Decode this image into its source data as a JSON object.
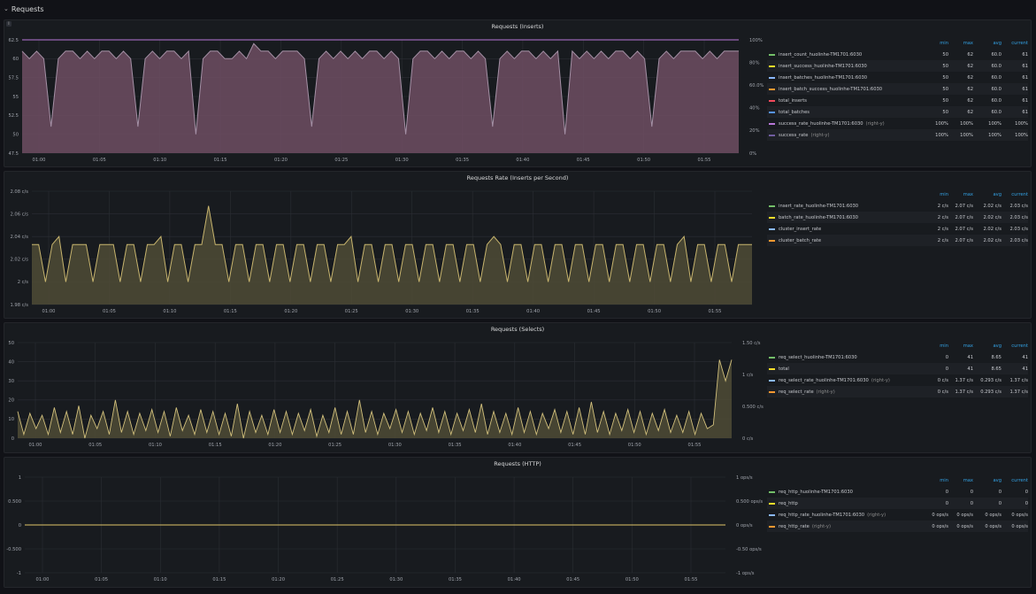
{
  "row": {
    "title": "Requests"
  },
  "panels": [
    {
      "title": "Requests (Inserts)",
      "legend": {
        "columns": [
          "min",
          "max",
          "avg",
          "current"
        ],
        "rows": [
          {
            "name": "insert_count_huolinhe-TM1701:6030",
            "axis": "",
            "color": "#73bf69",
            "vals": [
              "50",
              "62",
              "60.0",
              "61"
            ]
          },
          {
            "name": "insert_success_huolinhe-TM1701:6030",
            "axis": "",
            "color": "#fade2a",
            "vals": [
              "50",
              "62",
              "60.0",
              "61"
            ]
          },
          {
            "name": "insert_batches_huolinhe-TM1701:6030",
            "axis": "",
            "color": "#8ab8ff",
            "vals": [
              "50",
              "62",
              "60.0",
              "61"
            ]
          },
          {
            "name": "insert_batch_success_huolinhe-TM1701:6030",
            "axis": "",
            "color": "#ff9830",
            "vals": [
              "50",
              "62",
              "60.0",
              "61"
            ]
          },
          {
            "name": "total_inserts",
            "axis": "",
            "color": "#f2495c",
            "vals": [
              "50",
              "62",
              "60.0",
              "61"
            ]
          },
          {
            "name": "total_batches",
            "axis": "",
            "color": "#5794f2",
            "vals": [
              "50",
              "62",
              "60.0",
              "61"
            ]
          },
          {
            "name": "success_rate_huolinhe-TM1701:6030",
            "axis": "(right-y)",
            "color": "#b877d9",
            "vals": [
              "100%",
              "100%",
              "100%",
              "100%"
            ]
          },
          {
            "name": "success_rate",
            "axis": "(right-y)",
            "color": "#705da0",
            "vals": [
              "100%",
              "100%",
              "100%",
              "100%"
            ]
          }
        ]
      }
    },
    {
      "title": "Requests Rate (Inserts per Second)",
      "legend": {
        "columns": [
          "min",
          "max",
          "avg",
          "current"
        ],
        "rows": [
          {
            "name": "insert_rate_huolinhe-TM1701:6030",
            "axis": "",
            "color": "#73bf69",
            "vals": [
              "2 c/s",
              "2.07 c/s",
              "2.02 c/s",
              "2.03 c/s"
            ]
          },
          {
            "name": "batch_rate_huolinhe-TM1701:6030",
            "axis": "",
            "color": "#fade2a",
            "vals": [
              "2 c/s",
              "2.07 c/s",
              "2.02 c/s",
              "2.03 c/s"
            ]
          },
          {
            "name": "cluster_insert_rate",
            "axis": "",
            "color": "#8ab8ff",
            "vals": [
              "2 c/s",
              "2.07 c/s",
              "2.02 c/s",
              "2.03 c/s"
            ]
          },
          {
            "name": "cluster_batch_rate",
            "axis": "",
            "color": "#ff9830",
            "vals": [
              "2 c/s",
              "2.07 c/s",
              "2.02 c/s",
              "2.03 c/s"
            ]
          }
        ]
      }
    },
    {
      "title": "Requests (Selects)",
      "legend": {
        "columns": [
          "min",
          "max",
          "avg",
          "current"
        ],
        "rows": [
          {
            "name": "req_select_huolinhe-TM1701:6030",
            "axis": "",
            "color": "#73bf69",
            "vals": [
              "0",
              "41",
              "8.65",
              "41"
            ]
          },
          {
            "name": "total",
            "axis": "",
            "color": "#fade2a",
            "vals": [
              "0",
              "41",
              "8.65",
              "41"
            ]
          },
          {
            "name": "req_select_rate_huolinhe-TM1701:6030",
            "axis": "(right-y)",
            "color": "#8ab8ff",
            "vals": [
              "0 c/s",
              "1.37 c/s",
              "0.293 c/s",
              "1.37 c/s"
            ]
          },
          {
            "name": "req_select_rate",
            "axis": "(right-y)",
            "color": "#ff9830",
            "vals": [
              "0 c/s",
              "1.37 c/s",
              "0.293 c/s",
              "1.37 c/s"
            ]
          }
        ]
      }
    },
    {
      "title": "Requests (HTTP)",
      "legend": {
        "columns": [
          "min",
          "max",
          "avg",
          "current"
        ],
        "rows": [
          {
            "name": "req_http_huolinhe-TM1701:6030",
            "axis": "",
            "color": "#73bf69",
            "vals": [
              "0",
              "0",
              "0",
              "0"
            ]
          },
          {
            "name": "req_http",
            "axis": "",
            "color": "#fade2a",
            "vals": [
              "0",
              "0",
              "0",
              "0"
            ]
          },
          {
            "name": "req_http_rate_huolinhe-TM1701:6030",
            "axis": "(right-y)",
            "color": "#8ab8ff",
            "vals": [
              "0 ops/s",
              "0 ops/s",
              "0 ops/s",
              "0 ops/s"
            ]
          },
          {
            "name": "req_http_rate",
            "axis": "(right-y)",
            "color": "#ff9830",
            "vals": [
              "0 ops/s",
              "0 ops/s",
              "0 ops/s",
              "0 ops/s"
            ]
          }
        ]
      }
    }
  ],
  "chart_data": [
    {
      "type": "area",
      "title": "Requests (Inserts)",
      "x_ticks": [
        "01:00",
        "01:05",
        "01:10",
        "01:15",
        "01:20",
        "01:25",
        "01:30",
        "01:35",
        "01:40",
        "01:45",
        "01:50",
        "01:55"
      ],
      "y_ticks": [
        "47.5",
        "50",
        "52.5",
        "55",
        "57.5",
        "60",
        "62.5"
      ],
      "y2_ticks": [
        "0%",
        "20%",
        "40%",
        "60.0%",
        "80%",
        "100%"
      ],
      "ylim": [
        47.5,
        62.5
      ],
      "y2lim": [
        0,
        100
      ],
      "fill_color": "#6e4e63",
      "series": [
        {
          "name": "insert_count_huolinhe-TM1701:6030",
          "values": [
            61,
            60,
            61,
            60,
            51,
            60,
            61,
            61,
            60,
            61,
            60,
            61,
            61,
            60,
            61,
            60,
            51,
            60,
            61,
            60,
            61,
            61,
            60,
            61,
            50,
            60,
            61,
            61,
            60,
            60,
            61,
            60,
            62,
            61,
            61,
            60,
            61,
            61,
            61,
            60,
            51,
            60,
            61,
            60,
            61,
            60,
            61,
            60,
            61,
            61,
            60,
            61,
            60,
            50,
            60,
            61,
            61,
            60,
            61,
            60,
            61,
            61,
            60,
            61,
            60,
            51,
            60,
            61,
            60,
            61,
            61,
            60,
            61,
            60,
            61,
            50,
            61,
            60,
            61,
            60,
            61,
            60,
            61,
            61,
            60,
            61,
            60,
            51,
            60,
            61,
            60,
            61,
            61,
            61,
            60,
            61,
            60,
            61,
            61,
            61
          ]
        },
        {
          "name": "success_rate",
          "axis": "right-y",
          "values": [
            100,
            100,
            100,
            100,
            100,
            100,
            100,
            100,
            100,
            100
          ]
        }
      ]
    },
    {
      "type": "area",
      "title": "Requests Rate (Inserts per Second)",
      "x_ticks": [
        "01:00",
        "01:05",
        "01:10",
        "01:15",
        "01:20",
        "01:25",
        "01:30",
        "01:35",
        "01:40",
        "01:45",
        "01:50",
        "01:55"
      ],
      "y_ticks": [
        "1.98 c/s",
        "2 c/s",
        "2.02 c/s",
        "2.04 c/s",
        "2.06 c/s",
        "2.08 c/s"
      ],
      "ylim": [
        1.98,
        2.08
      ],
      "fill_color": "#4f4b36",
      "series": [
        {
          "name": "insert_rate_huolinhe-TM1701:6030",
          "values": [
            2.033,
            2.033,
            2.0,
            2.033,
            2.04,
            2.0,
            2.033,
            2.033,
            2.033,
            2.0,
            2.033,
            2.033,
            2.033,
            2.0,
            2.033,
            2.033,
            2.0,
            2.033,
            2.033,
            2.04,
            2.0,
            2.033,
            2.033,
            2.0,
            2.033,
            2.033,
            2.067,
            2.033,
            2.033,
            2.0,
            2.033,
            2.033,
            2.0,
            2.033,
            2.033,
            2.0,
            2.033,
            2.033,
            2.0,
            2.033,
            2.033,
            2.0,
            2.033,
            2.033,
            2.0,
            2.033,
            2.033,
            2.04,
            2.0,
            2.033,
            2.033,
            2.0,
            2.033,
            2.033,
            2.0,
            2.033,
            2.033,
            2.0,
            2.033,
            2.033,
            2.0,
            2.033,
            2.033,
            2.0,
            2.033,
            2.033,
            2.0,
            2.033,
            2.04,
            2.033,
            2.0,
            2.033,
            2.033,
            2.0,
            2.033,
            2.033,
            2.0,
            2.033,
            2.033,
            2.0,
            2.033,
            2.033,
            2.0,
            2.033,
            2.033,
            2.0,
            2.033,
            2.033,
            2.0,
            2.033,
            2.033,
            2.0,
            2.033,
            2.033,
            2.0,
            2.033,
            2.04,
            2.0,
            2.033,
            2.033,
            2.0,
            2.033,
            2.033,
            2.0,
            2.033,
            2.033,
            2.033
          ]
        }
      ]
    },
    {
      "type": "area",
      "title": "Requests (Selects)",
      "x_ticks": [
        "01:00",
        "01:05",
        "01:10",
        "01:15",
        "01:20",
        "01:25",
        "01:30",
        "01:35",
        "01:40",
        "01:45",
        "01:50",
        "01:55"
      ],
      "y_ticks": [
        "0",
        "10",
        "20",
        "30",
        "40",
        "50"
      ],
      "y2_ticks": [
        "0 c/s",
        "0.500 c/s",
        "1 c/s",
        "1.50 c/s"
      ],
      "ylim": [
        0,
        50
      ],
      "y2lim": [
        0,
        1.5
      ],
      "fill_color": "#4f4b36",
      "series": [
        {
          "name": "total",
          "values": [
            14,
            2,
            13,
            5,
            12,
            2,
            16,
            3,
            14,
            2,
            17,
            0,
            12,
            5,
            14,
            2,
            20,
            3,
            14,
            2,
            13,
            4,
            15,
            3,
            14,
            1,
            16,
            4,
            12,
            2,
            15,
            3,
            14,
            2,
            13,
            1,
            18,
            0,
            14,
            3,
            12,
            2,
            15,
            3,
            14,
            2,
            13,
            4,
            15,
            1,
            12,
            3,
            16,
            2,
            14,
            2,
            20,
            3,
            14,
            2,
            13,
            5,
            15,
            3,
            14,
            2,
            13,
            4,
            16,
            3,
            14,
            2,
            13,
            4,
            15,
            3,
            18,
            2,
            14,
            3,
            13,
            2,
            16,
            3,
            14,
            2,
            13,
            5,
            15,
            3,
            14,
            2,
            16,
            2,
            19,
            3,
            14,
            2,
            13,
            4,
            15,
            3,
            14,
            2,
            13,
            4,
            15,
            3,
            12,
            3,
            14,
            2,
            13,
            5,
            7,
            41,
            30,
            41
          ]
        }
      ]
    },
    {
      "type": "line",
      "title": "Requests (HTTP)",
      "x_ticks": [
        "01:00",
        "01:05",
        "01:10",
        "01:15",
        "01:20",
        "01:25",
        "01:30",
        "01:35",
        "01:40",
        "01:45",
        "01:50",
        "01:55"
      ],
      "y_ticks": [
        "-1",
        "-0.500",
        "0",
        "0.500",
        "1"
      ],
      "y2_ticks": [
        "-1 ops/s",
        "-0.50 ops/s",
        "0 ops/s",
        "0.500 ops/s",
        "1 ops/s"
      ],
      "ylim": [
        -1,
        1
      ],
      "series": [
        {
          "name": "req_http",
          "values": [
            0,
            0
          ]
        }
      ]
    }
  ]
}
